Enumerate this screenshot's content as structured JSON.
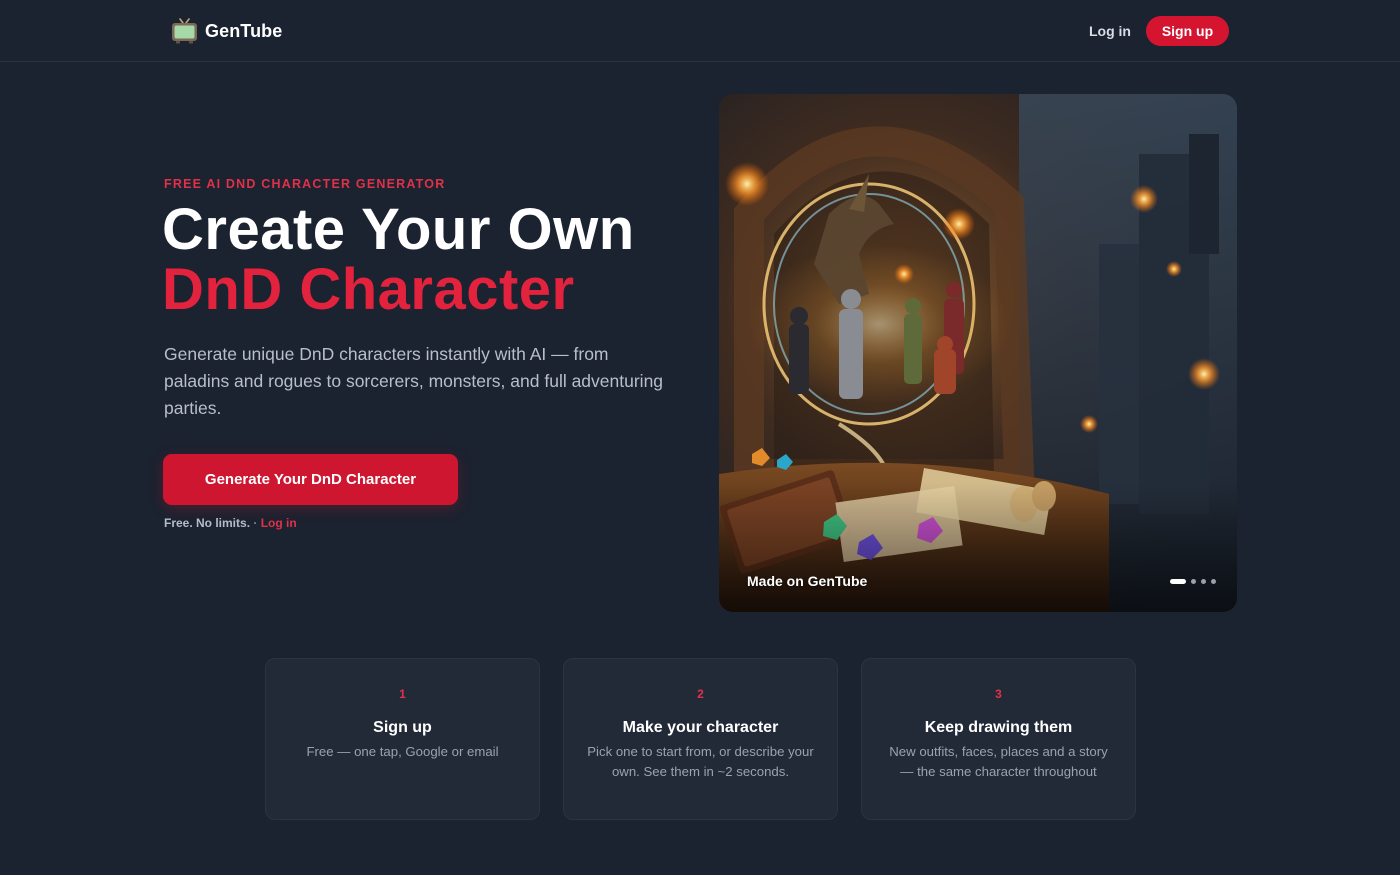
{
  "header": {
    "brand_name": "GenTube",
    "brand_icon": "tv-icon",
    "login_label": "Log in",
    "signup_label": "Sign up"
  },
  "hero": {
    "eyebrow": "FREE AI DND CHARACTER GENERATOR",
    "headline_line1": "Create Your Own",
    "headline_line2": "DnD Character",
    "description": "Generate unique DnD characters instantly with AI — from paladins and rogues to sorcerers, monsters, and full adventuring parties.",
    "cta_label": "Generate Your DnD Character",
    "subnote_free": "Free. No limits.",
    "subnote_sep": "·",
    "subnote_login": "Log in",
    "image_caption": "Made on GenTube",
    "carousel_slides": 4,
    "carousel_active_index": 0
  },
  "steps": [
    {
      "number": "1",
      "title": "Sign up",
      "description": "Free — one tap, Google or email"
    },
    {
      "number": "2",
      "title": "Make your character",
      "description": "Pick one to start from, or describe your own. See them in ~2 seconds."
    },
    {
      "number": "3",
      "title": "Keep drawing them",
      "description": "New outfits, faces, places and a story — the same character throughout"
    }
  ],
  "colors": {
    "background": "#1b2230",
    "accent": "#d5152f",
    "accent_text": "#e3233d",
    "card": "#222a38"
  }
}
